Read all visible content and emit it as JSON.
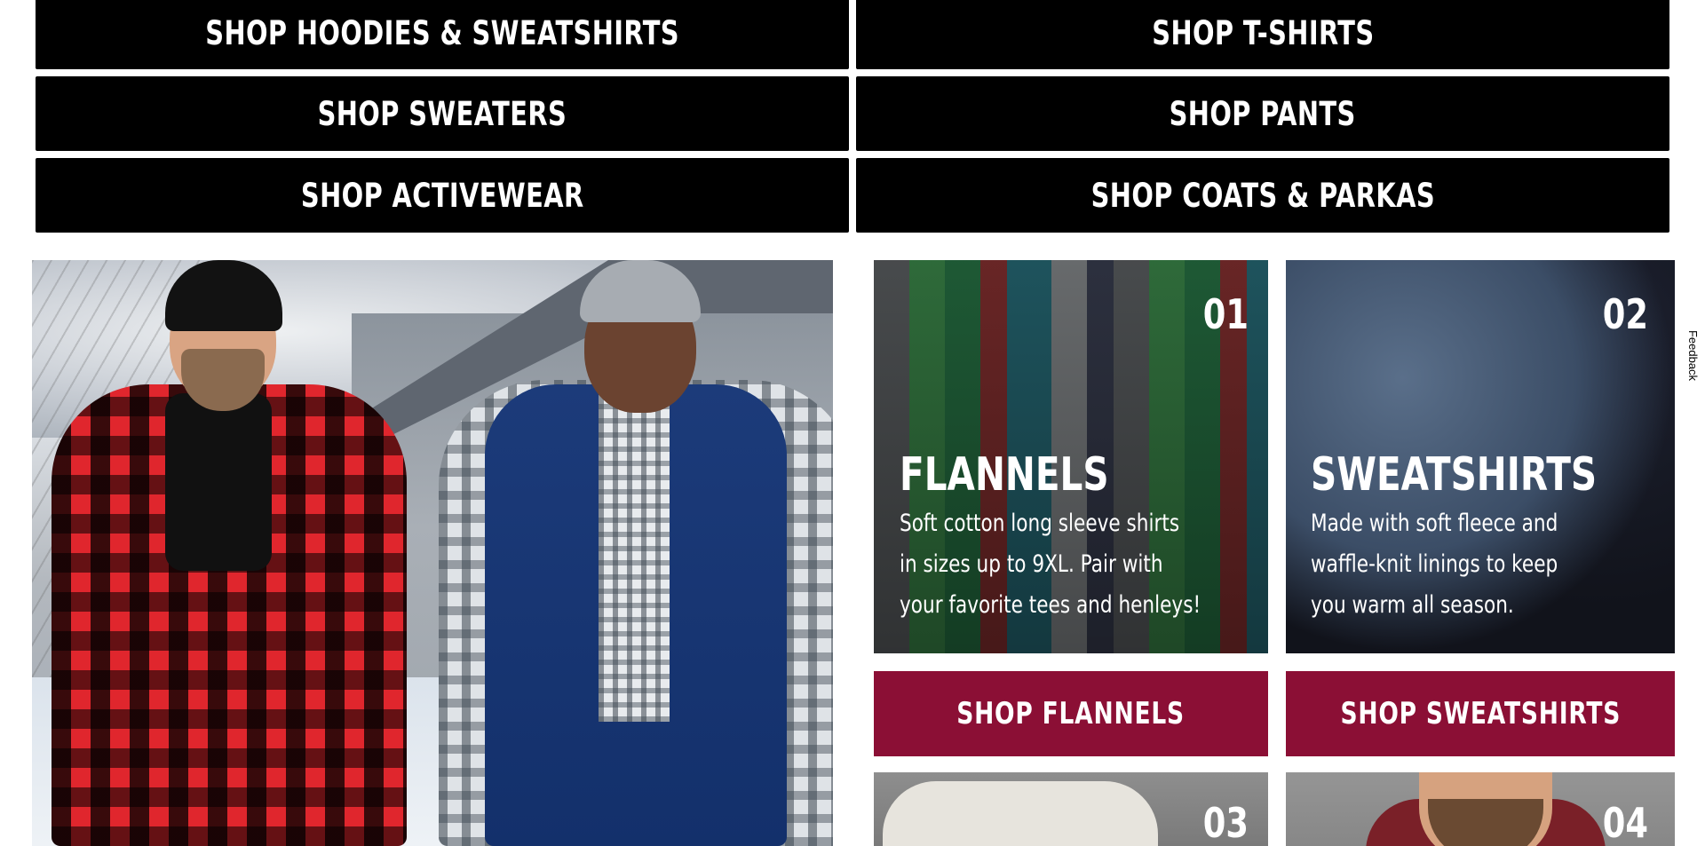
{
  "categories": [
    {
      "label": "SHOP HOODIES & SWEATSHIRTS"
    },
    {
      "label": "SHOP T-SHIRTS"
    },
    {
      "label": "SHOP SWEATERS"
    },
    {
      "label": "SHOP PANTS"
    },
    {
      "label": "SHOP ACTIVEWEAR"
    },
    {
      "label": "SHOP COATS & PARKAS"
    }
  ],
  "tiles": [
    {
      "number": "01",
      "title": "FLANNELS",
      "description_lines": [
        "Soft cotton long sleeve shirts",
        "in sizes up to 9XL. Pair with",
        "your favorite tees and henleys!"
      ],
      "button_label": "SHOP FLANNELS"
    },
    {
      "number": "02",
      "title": "SWEATSHIRTS",
      "description_lines": [
        "Made with soft fleece and",
        "waffle-knit linings to keep",
        "you warm all season."
      ],
      "button_label": "SHOP SWEATSHIRTS"
    },
    {
      "number": "03"
    },
    {
      "number": "04"
    }
  ],
  "feedback": {
    "label": "Feedback"
  },
  "colors": {
    "category_button_bg": "#000000",
    "shop_button_bg": "#8b0f35",
    "text_light": "#ffffff"
  }
}
